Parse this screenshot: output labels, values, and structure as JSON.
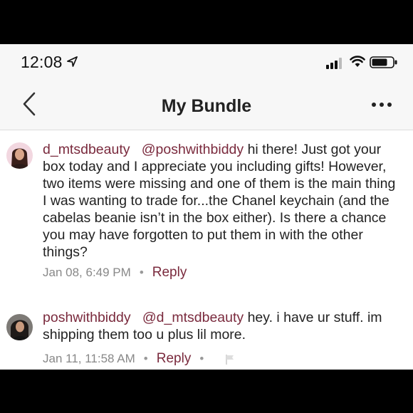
{
  "status_bar": {
    "time": "12:08",
    "icons": [
      "location-arrow-icon",
      "cellular-signal-icon",
      "wifi-icon",
      "battery-icon"
    ]
  },
  "nav": {
    "title": "My Bundle",
    "back_icon": "chevron-left-icon",
    "more_icon": "more-dots-icon"
  },
  "comments": [
    {
      "username": "d_mtsdbeauty",
      "mention": "@poshwithbiddy",
      "text": "hi there! Just got your box today and I appreciate you including gifts! However, two items were missing and one of them is the main thing I was wanting to trade for...the Chanel keychain (and the cabelas beanie isn’t in the box either). Is there a chance you may have forgotten to put them in with the other things?",
      "timestamp": "Jan 08, 6:49 PM",
      "reply_label": "Reply"
    },
    {
      "username": "poshwithbiddy",
      "mention": "@d_mtsdbeauty",
      "text": "hey. i have ur stuff. im shipping them too u plus lil more.",
      "timestamp": "Jan 11, 11:58 AM",
      "reply_label": "Reply",
      "extra_icon": "flag-icon"
    }
  ],
  "colors": {
    "accent": "#7a2a3d",
    "meta_text": "#888888",
    "bar_background": "#f7f7f7"
  }
}
